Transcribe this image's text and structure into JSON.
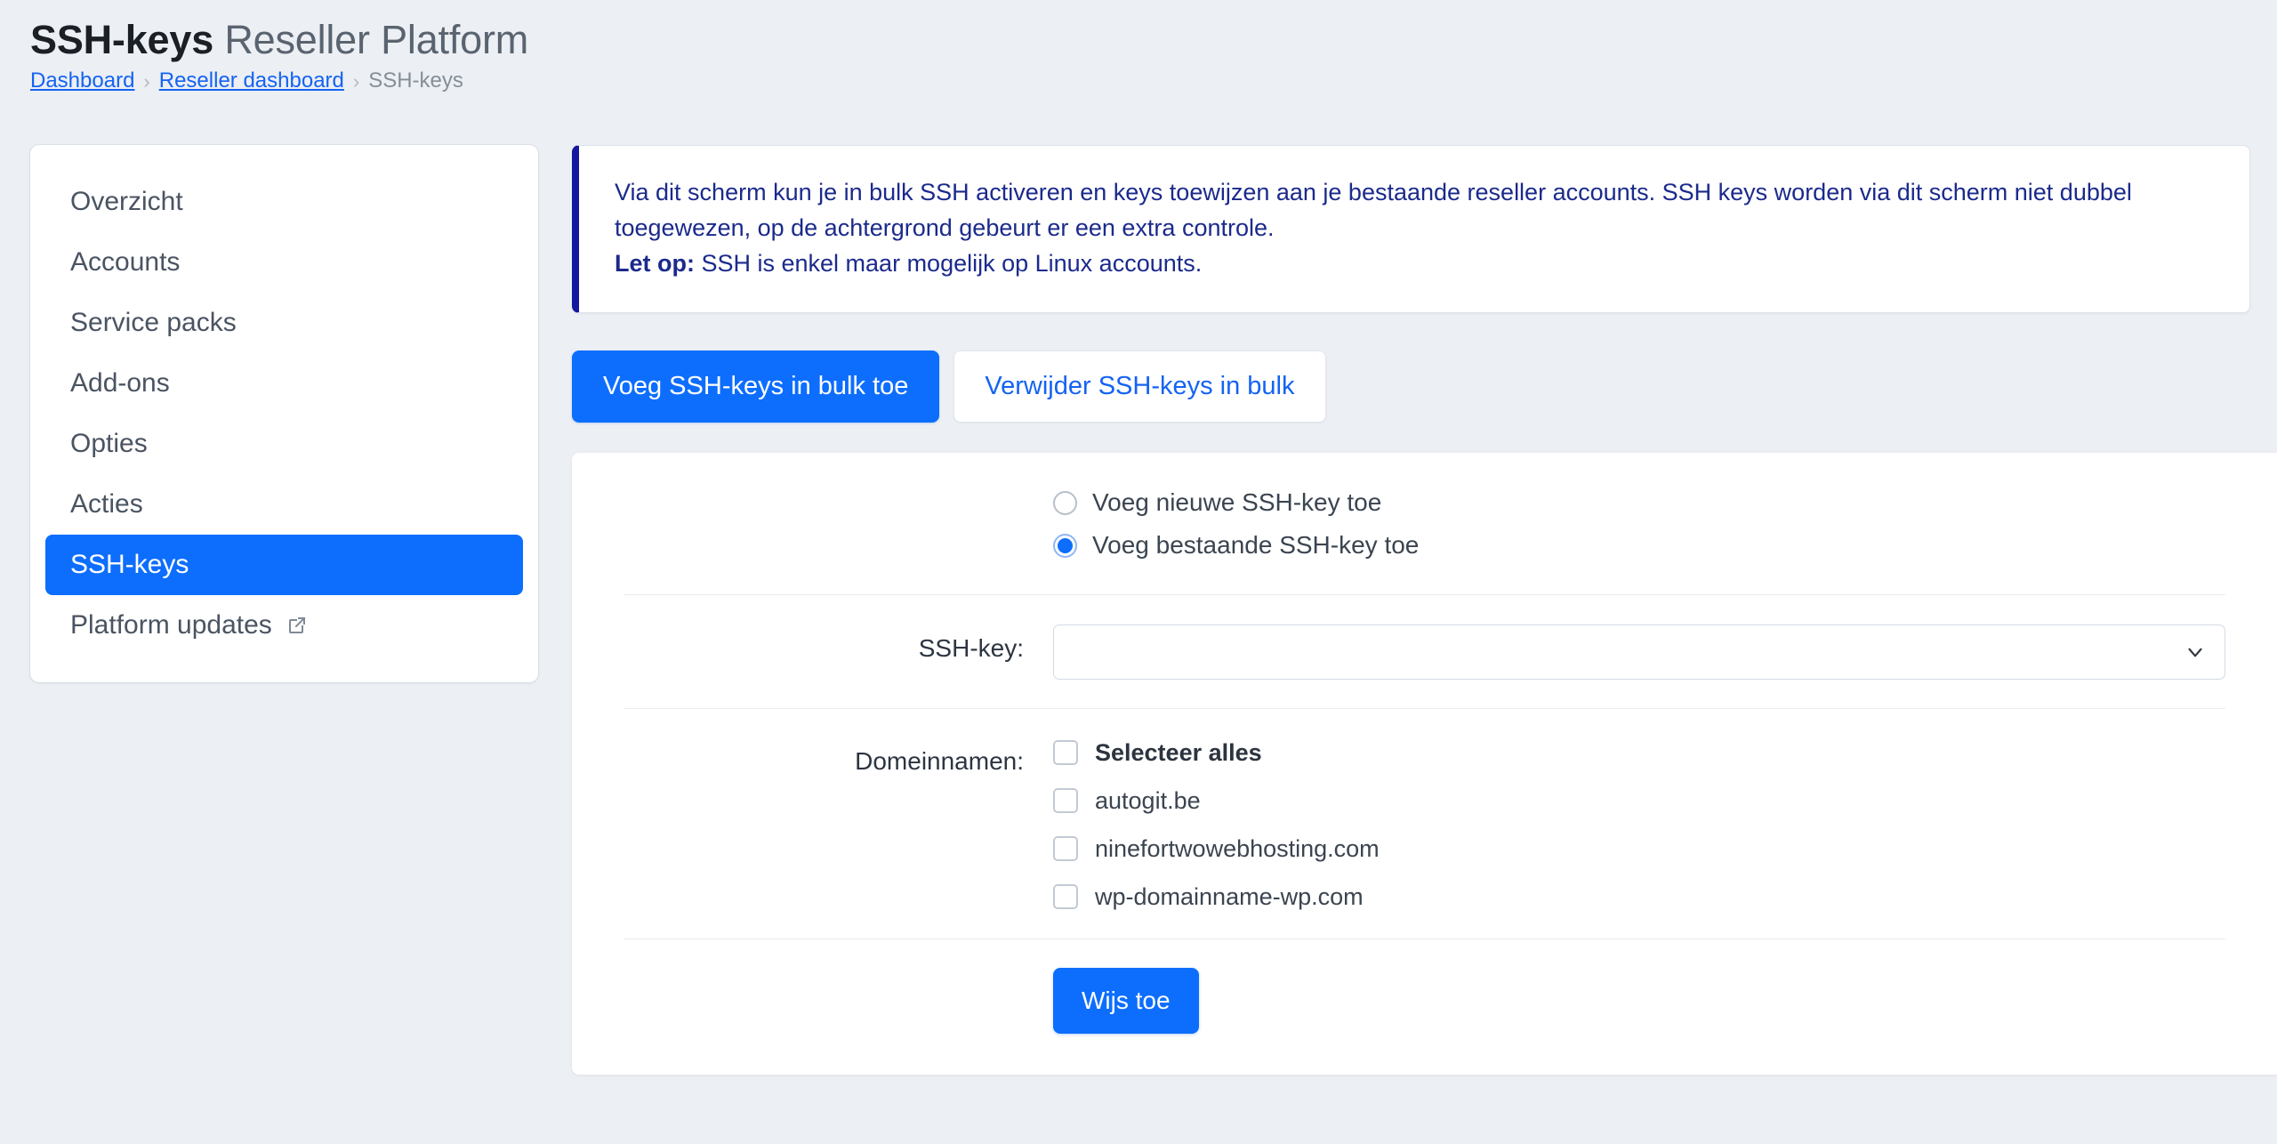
{
  "header": {
    "title_strong": "SSH-keys",
    "title_rest": " Reseller Platform",
    "breadcrumb": {
      "item1": "Dashboard",
      "sep1": "›",
      "item2": "Reseller dashboard",
      "sep2": "›",
      "current": "SSH-keys"
    }
  },
  "sidebar": {
    "items": [
      {
        "label": "Overzicht",
        "active": false,
        "external": false
      },
      {
        "label": "Accounts",
        "active": false,
        "external": false
      },
      {
        "label": "Service packs",
        "active": false,
        "external": false
      },
      {
        "label": "Add-ons",
        "active": false,
        "external": false
      },
      {
        "label": "Opties",
        "active": false,
        "external": false
      },
      {
        "label": "Acties",
        "active": false,
        "external": false
      },
      {
        "label": "SSH-keys",
        "active": true,
        "external": false
      },
      {
        "label": "Platform updates",
        "active": false,
        "external": true
      }
    ]
  },
  "alert": {
    "paragraph1": "Via dit scherm kun je in bulk SSH activeren en keys toewijzen aan je bestaande reseller accounts. SSH keys worden via dit scherm niet dubbel toegewezen, op de achtergrond gebeurt er een extra controle.",
    "note_label": "Let op:",
    "note_text": " SSH is enkel maar mogelijk op Linux accounts.",
    "accent_color": "#14189e",
    "text_color": "#1b2a8c"
  },
  "tabs": {
    "add": "Voeg SSH-keys in bulk toe",
    "remove": "Verwijder SSH-keys in bulk",
    "active": "add",
    "active_color": "#0d6efd",
    "inactive_text_color": "#1463f3"
  },
  "form": {
    "radio_options": [
      {
        "label": "Voeg nieuwe SSH-key toe",
        "selected": false
      },
      {
        "label": "Voeg bestaande SSH-key toe",
        "selected": true
      }
    ],
    "ssh_key": {
      "label": "SSH-key:",
      "value": "",
      "placeholder": ""
    },
    "domains": {
      "label": "Domeinnamen:",
      "select_all_label": "Selecteer alles",
      "select_all_checked": false,
      "items": [
        {
          "label": "autogit.be",
          "checked": false
        },
        {
          "label": "ninefortwowebhosting.com",
          "checked": false
        },
        {
          "label": "wp-domainname-wp.com",
          "checked": false
        }
      ]
    },
    "submit_label": "Wijs toe"
  }
}
